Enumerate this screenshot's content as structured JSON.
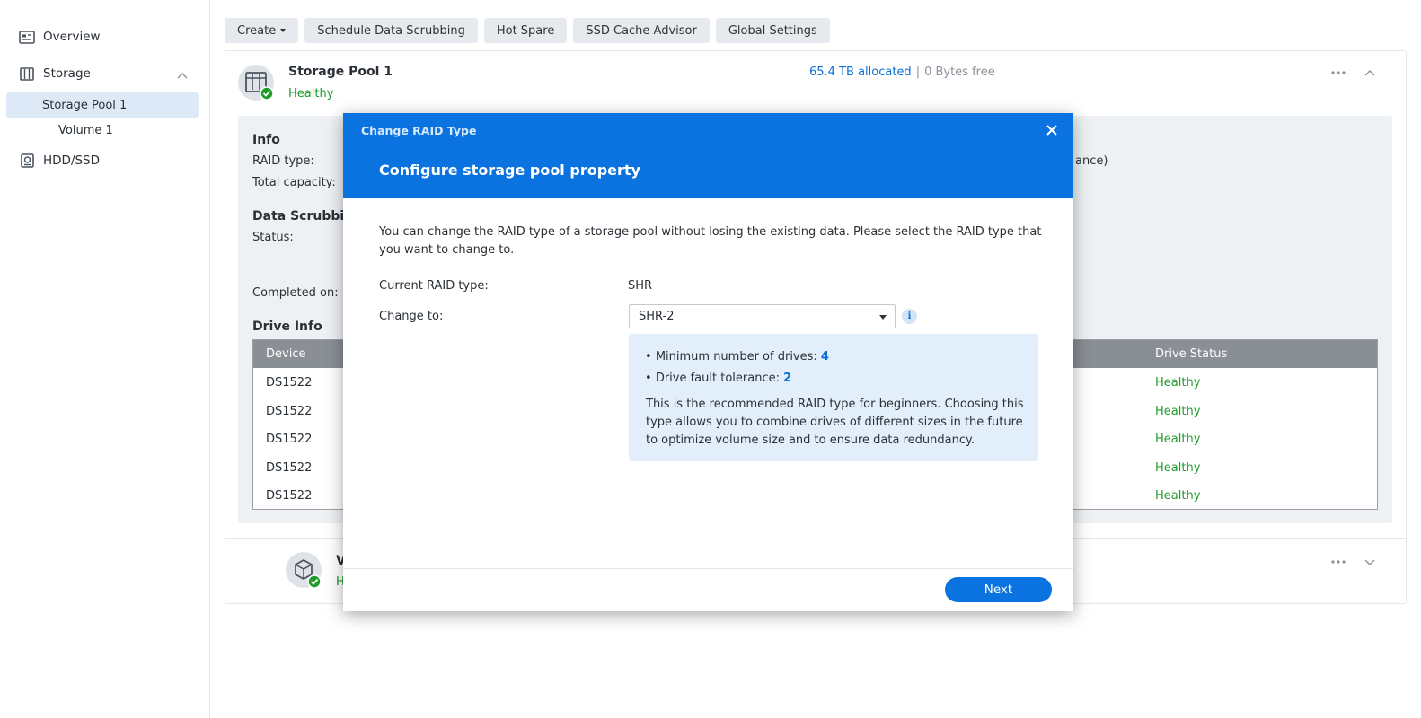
{
  "sidebar": {
    "overview": "Overview",
    "storage": "Storage",
    "storage_pool": "Storage Pool 1",
    "volume": "Volume 1",
    "hdd": "HDD/SSD"
  },
  "toolbar": {
    "create": "Create",
    "schedule": "Schedule Data Scrubbing",
    "hot_spare": "Hot Spare",
    "ssd_cache": "SSD Cache Advisor",
    "global": "Global Settings"
  },
  "pool": {
    "title": "Storage Pool 1",
    "status": "Healthy",
    "allocated": "65.4 TB allocated",
    "separator": "|",
    "free": "0 Bytes free",
    "info_heading": "Info",
    "raid_type_label": "RAID type:",
    "total_capacity_label": "Total capacity:",
    "raid_suffix_partial": "ance)",
    "scrub_heading_partial": "Data Scrubbin",
    "status_label": "Status:",
    "completed_label": "Completed on:",
    "drive_info_heading": "Drive Info",
    "table": {
      "col_device": "Device",
      "col_status": "Drive Status",
      "rows": [
        {
          "device": "DS1522",
          "status": "Healthy"
        },
        {
          "device": "DS1522",
          "status": "Healthy"
        },
        {
          "device": "DS1522",
          "status": "Healthy"
        },
        {
          "device": "DS1522",
          "status": "Healthy"
        },
        {
          "device": "DS1522",
          "status": "Healthy"
        }
      ]
    }
  },
  "volume_card": {
    "title_partial": "V",
    "status_partial": "H"
  },
  "dialog": {
    "window_title": "Change RAID Type",
    "heading": "Configure storage pool property",
    "description": "You can change the RAID type of a storage pool without losing the existing data. Please select the RAID type that you want to change to.",
    "current_label": "Current RAID type:",
    "current_value": "SHR",
    "change_label": "Change to:",
    "selected": "SHR-2",
    "info_glyph": "i",
    "min_drives_label": "Minimum number of drives:",
    "min_drives_value": "4",
    "fault_label": "Drive fault tolerance:",
    "fault_value": "2",
    "recommendation": "This is the recommended RAID type for beginners. Choosing this type allows you to combine drives of different sizes in the future to optimize volume size and to ensure data redundancy.",
    "next": "Next"
  },
  "colors": {
    "accent": "#0b73e0",
    "healthy": "#1f9d28",
    "link": "#0b6fd6"
  },
  "icons": [
    "overview-icon",
    "storage-icon",
    "chevron-up-icon",
    "hdd-icon",
    "pool-icon",
    "check-badge-icon",
    "more-icon",
    "chevron-down-icon",
    "volume-cube-icon",
    "close-icon",
    "info-icon",
    "dropdown-caret-icon"
  ]
}
